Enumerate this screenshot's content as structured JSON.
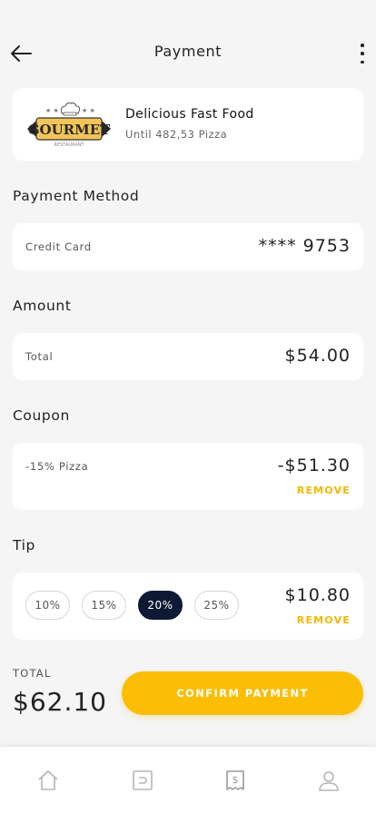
{
  "header": {
    "title": "Payment"
  },
  "restaurant": {
    "name": "Delicious Fast Food",
    "subtitle": "Until 482,53 Pizza",
    "logo_text": "GOURMET",
    "logo_subtext": "RESTAURANT"
  },
  "payment_method": {
    "label": "Payment Method",
    "type": "Credit Card",
    "card_number": "**** 9753"
  },
  "amount": {
    "label": "Amount",
    "row_label": "Total",
    "value": "$54.00"
  },
  "coupon": {
    "label": "Coupon",
    "row_label": "-15% Pizza",
    "value": "-$51.30",
    "remove": "REMOVE"
  },
  "tip": {
    "label": "Tip",
    "options": [
      "10%",
      "15%",
      "20%",
      "25%"
    ],
    "selected": "20%",
    "value": "$10.80",
    "remove": "REMOVE"
  },
  "summary": {
    "total_label": "TOTAL",
    "total_value": "$62.10",
    "confirm": "CONFIRM PAYMENT"
  },
  "tabbar": {
    "icons": [
      "home-icon",
      "wallet-icon",
      "receipt-icon",
      "profile-icon"
    ]
  },
  "colors": {
    "accent": "#fcbd05",
    "selected_tip": "#0e1a33",
    "background": "#f5f5f6"
  }
}
